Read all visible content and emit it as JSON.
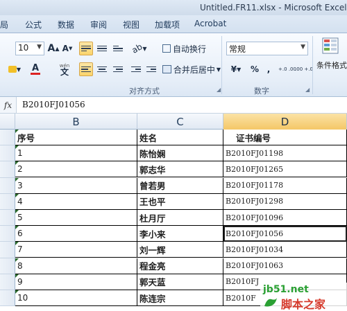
{
  "window": {
    "title": "Untitled.FR11.xlsx - Microsoft Excel"
  },
  "tabs": [
    "局",
    "公式",
    "数据",
    "审阅",
    "视图",
    "加载项",
    "Acrobat"
  ],
  "ribbon": {
    "font_size": "10",
    "grow_font": "A",
    "shrink_font": "A",
    "wen_label": "wén",
    "wen_char": "文",
    "wrap_text": "自动换行",
    "merge_center": "合并后居中",
    "number_format": "常规",
    "currency": "¥",
    "percent": "%",
    "comma": ",",
    "inc_decimal": "+.0 .00",
    "dec_decimal": ".00 +.0",
    "conditional_format": "条件格式",
    "group_alignment": "对齐方式",
    "group_number": "数字",
    "accent": "#fbd46b"
  },
  "formula_bar": {
    "fx": "fx",
    "value": "B2010FJ01056"
  },
  "columns": [
    "B",
    "C",
    "D"
  ],
  "headers": {
    "b": "序号",
    "c": "姓名",
    "d": "证书编号"
  },
  "rows": [
    {
      "no": "1",
      "name": "陈怡娴",
      "cert": "B2010FJ01198"
    },
    {
      "no": "2",
      "name": "郭志华",
      "cert": "B2010FJ01265"
    },
    {
      "no": "3",
      "name": "曾若男",
      "cert": "B2010FJ01178"
    },
    {
      "no": "4",
      "name": "王也平",
      "cert": "B2010FJ01298"
    },
    {
      "no": "5",
      "name": "杜月厅",
      "cert": "B2010FJ01096"
    },
    {
      "no": "6",
      "name": "李小来",
      "cert": "B2010FJ01056"
    },
    {
      "no": "7",
      "name": "刘一辉",
      "cert": "B2010FJ01034"
    },
    {
      "no": "8",
      "name": "程金亮",
      "cert": "B2010FJ01063"
    },
    {
      "no": "9",
      "name": "郭天蓝",
      "cert": "B2010FJ"
    },
    {
      "no": "10",
      "name": "陈连宗",
      "cert": "B2010F"
    }
  ],
  "watermark": {
    "site": "jb51.net",
    "brand": "脚本之家"
  }
}
